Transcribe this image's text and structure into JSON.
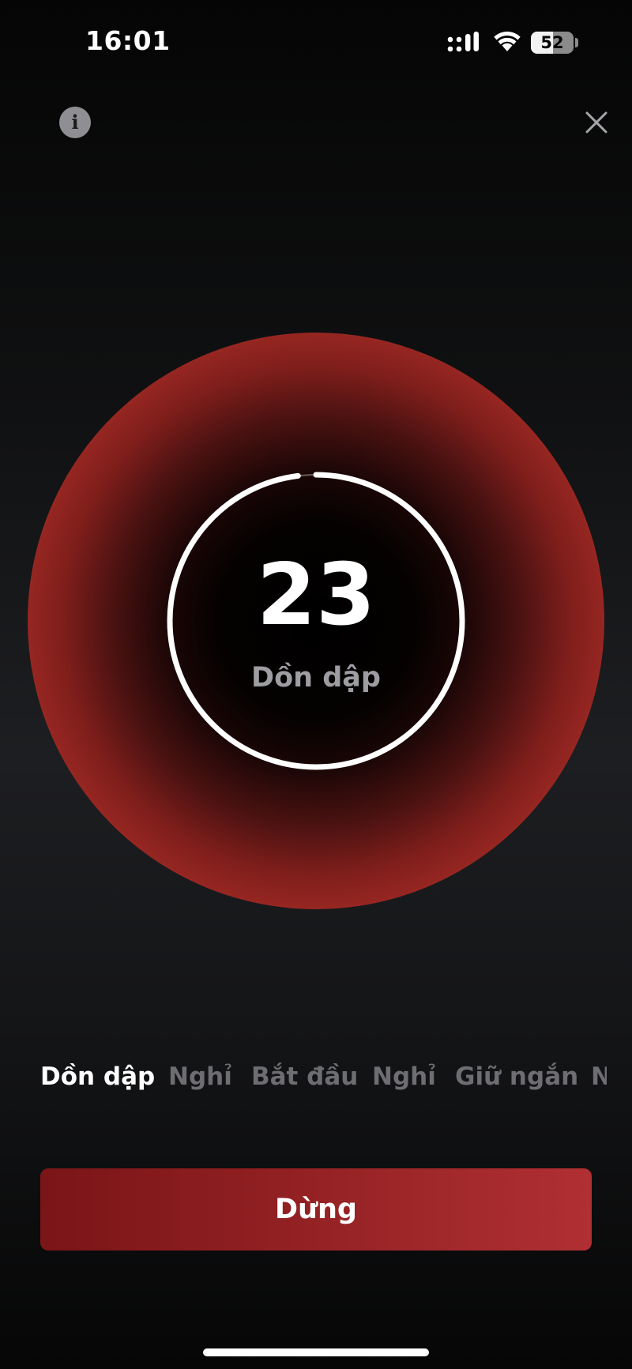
{
  "status_bar": {
    "time": "16:01",
    "battery_level": "52",
    "signal_icon": "cellular-signal-icon",
    "wifi_icon": "wifi-icon",
    "battery_icon": "battery-icon"
  },
  "header": {
    "info_icon": "info-icon",
    "info_glyph": "i",
    "close_icon": "close-icon"
  },
  "timer": {
    "count": "23",
    "phase": "Dồn dập",
    "progress": 0.98,
    "ring_color": "#ffffff",
    "circle_color": "#a32a25"
  },
  "phases": [
    {
      "label": "Dồn dập",
      "active": true
    },
    {
      "label": "Nghỉ",
      "active": false
    },
    {
      "label": "Bắt đầu",
      "active": false
    },
    {
      "label": "Nghỉ",
      "active": false
    },
    {
      "label": "Giữ ngắn",
      "active": false
    },
    {
      "label": "N",
      "active": false
    }
  ],
  "stop_button": {
    "label": "Dừng"
  },
  "colors": {
    "accent": "#a32a25",
    "button": "#9a2427",
    "inactive_text": "#6d6d72"
  }
}
